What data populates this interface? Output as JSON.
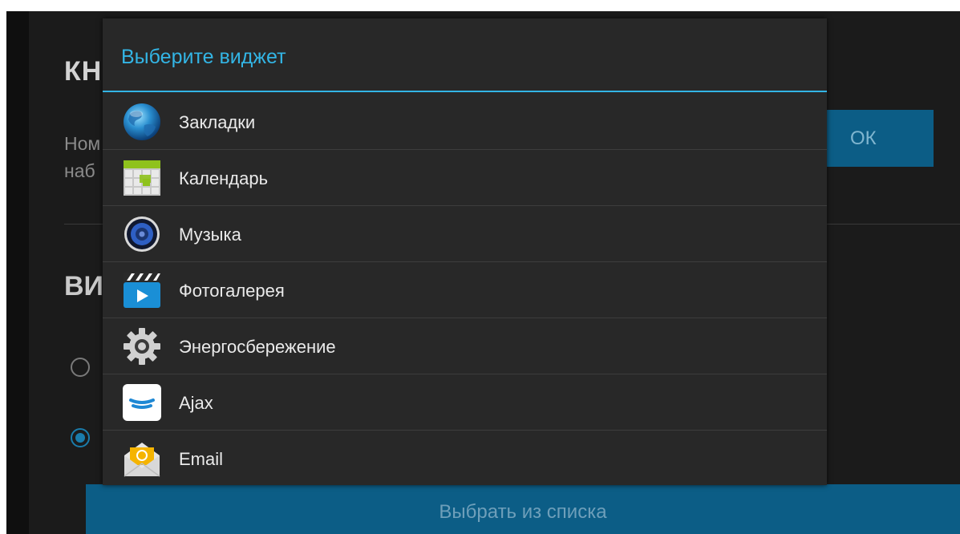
{
  "background": {
    "title": "КН",
    "text_line1": "Ном",
    "text_line2": "наб",
    "ok_button": "ОК",
    "section_title": "ВИ",
    "select_button": "Выбрать из списка"
  },
  "dialog": {
    "title": "Выберите виджет",
    "items": [
      {
        "label": "Закладки",
        "icon": "globe-icon"
      },
      {
        "label": "Календарь",
        "icon": "calendar-icon"
      },
      {
        "label": "Музыка",
        "icon": "speaker-icon"
      },
      {
        "label": "Фотогалерея",
        "icon": "clapperboard-icon"
      },
      {
        "label": "Энергосбережение",
        "icon": "gear-icon"
      },
      {
        "label": "Ajax",
        "icon": "ajax-logo-icon"
      },
      {
        "label": "Email",
        "icon": "email-icon"
      }
    ]
  },
  "colors": {
    "accent": "#33b5e5",
    "button": "#0c5d86",
    "dialog_bg": "#282828"
  }
}
